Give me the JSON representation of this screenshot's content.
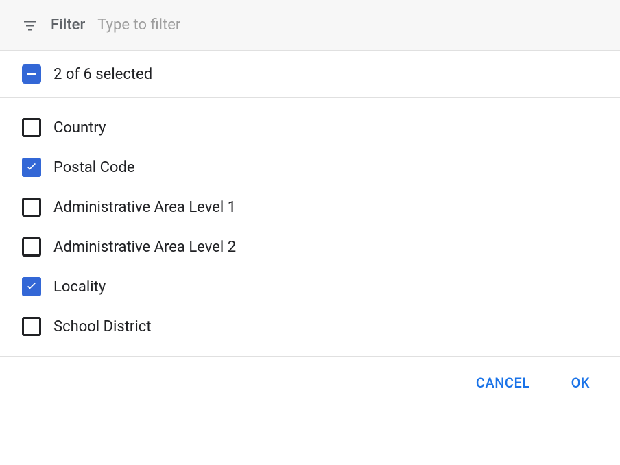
{
  "filter": {
    "label": "Filter",
    "placeholder": "Type to filter"
  },
  "summary": {
    "text": "2 of 6 selected"
  },
  "options": [
    {
      "label": "Country",
      "checked": false
    },
    {
      "label": "Postal Code",
      "checked": true
    },
    {
      "label": "Administrative Area Level 1",
      "checked": false
    },
    {
      "label": "Administrative Area Level 2",
      "checked": false
    },
    {
      "label": "Locality",
      "checked": true
    },
    {
      "label": "School District",
      "checked": false
    }
  ],
  "buttons": {
    "cancel": "CANCEL",
    "ok": "OK"
  }
}
